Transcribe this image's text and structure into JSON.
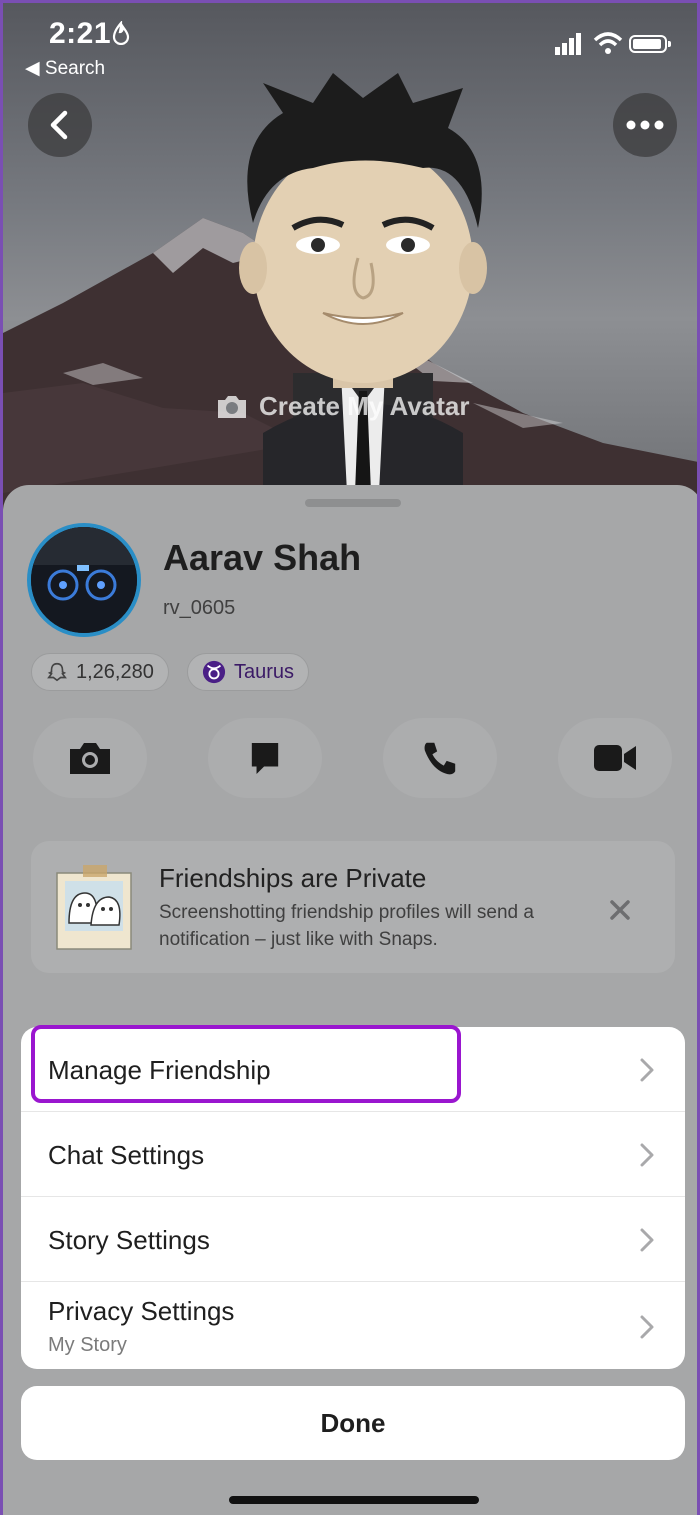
{
  "status_bar": {
    "time": "2:21",
    "back_app": "Search"
  },
  "hero": {
    "create_avatar_label": "Create My Avatar"
  },
  "profile": {
    "name": "Aarav Shah",
    "username": "rv_0605",
    "snap_score": "1,26,280",
    "zodiac": "Taurus"
  },
  "notice": {
    "title": "Friendships are Private",
    "text": "Screenshotting friendship profiles will send a notification – just like with Snaps."
  },
  "menu": {
    "items": [
      {
        "label": "Manage Friendship"
      },
      {
        "label": "Chat Settings"
      },
      {
        "label": "Story Settings"
      },
      {
        "label": "Privacy Settings",
        "sub": "My Story"
      }
    ]
  },
  "done_label": "Done",
  "colors": {
    "highlight": "#9a16cf",
    "profile_ring": "#2a8ec6",
    "zodiac_accent": "#4a1f86"
  }
}
